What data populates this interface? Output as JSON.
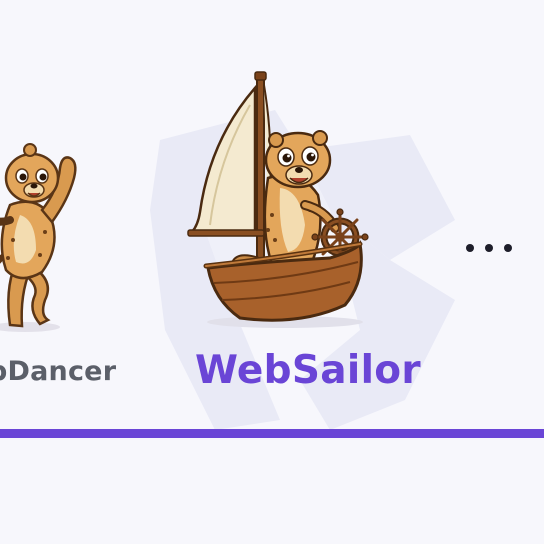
{
  "items": [
    {
      "name": "WebDancer",
      "visible_text": "bDancer"
    },
    {
      "name": "WebSailor",
      "visible_text": "WebSailor"
    }
  ],
  "more_icon": "ellipsis-icon",
  "colors": {
    "background": "#f7f7fc",
    "accent": "#6a45d6",
    "secondary_text": "#5b5f69",
    "watermark": "#e8e9f6"
  }
}
